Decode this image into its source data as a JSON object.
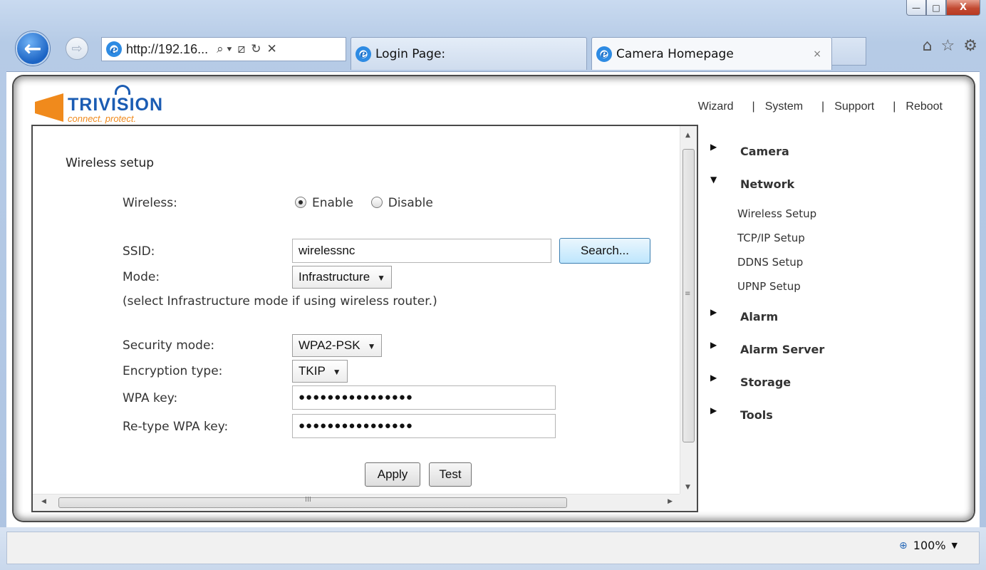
{
  "window": {
    "minimize_glyph": "—",
    "maximize_glyph": "□",
    "close_glyph": "X"
  },
  "browser": {
    "back_glyph": "←",
    "forward_glyph": "⇨",
    "address": "http://192.16...",
    "address_tools": [
      "⌕ ▾",
      "⧄",
      "↻",
      "✕"
    ],
    "tabs": [
      {
        "label": "Login Page:",
        "active": false
      },
      {
        "label": "Camera Homepage",
        "active": true,
        "close_glyph": "×"
      }
    ],
    "tool_icons": [
      {
        "name": "home-icon",
        "glyph": "⌂"
      },
      {
        "name": "favorites-star-icon",
        "glyph": "☆"
      },
      {
        "name": "settings-gear-icon",
        "glyph": "⚙"
      }
    ],
    "zoom": "100%",
    "zoom_icon_glyph": "⊕",
    "zoom_caret": "▼"
  },
  "brand": {
    "name": "TRIVISION",
    "tagline": "connect. protect.",
    "colors": {
      "blue": "#1b5cb3",
      "orange": "#f08a1c"
    }
  },
  "top_menu": {
    "items": [
      "Wizard",
      "System",
      "Support",
      "Reboot"
    ],
    "separator": "|"
  },
  "form": {
    "heading": "Wireless setup",
    "wireless": {
      "label": "Wireless:",
      "options": [
        "Enable",
        "Disable"
      ],
      "selected": "Enable"
    },
    "ssid": {
      "label": "SSID:",
      "value": "wirelessnc",
      "button": "Search..."
    },
    "mode": {
      "label": "Mode:",
      "value": "Infrastructure",
      "hint": "(select Infrastructure mode if using wireless router.)"
    },
    "security_mode": {
      "label": "Security mode:",
      "value": "WPA2-PSK"
    },
    "encryption_type": {
      "label": "Encryption type:",
      "value": "TKIP"
    },
    "wpa_key": {
      "label": "WPA key:",
      "value": "●●●●●●●●●●●●●●●●"
    },
    "retype_wpa_key": {
      "label": "Re-type WPA key:",
      "value": "●●●●●●●●●●●●●●●●"
    },
    "apply_button": "Apply",
    "test_button": "Test",
    "caret": "▼"
  },
  "scrollbars": {
    "up": "▲",
    "down": "▼",
    "left": "◀",
    "right": "▶",
    "v_grip": "≡",
    "h_grip": "III"
  },
  "side_nav": {
    "collapsed_glyph": "▶",
    "expanded_glyph": "▼",
    "groups": [
      {
        "label": "Camera",
        "expanded": false
      },
      {
        "label": "Network",
        "expanded": true,
        "items": [
          "Wireless Setup",
          "TCP/IP Setup",
          "DDNS Setup",
          "UPNP Setup"
        ]
      },
      {
        "label": "Alarm",
        "expanded": false
      },
      {
        "label": "Alarm Server",
        "expanded": false
      },
      {
        "label": "Storage",
        "expanded": false
      },
      {
        "label": "Tools",
        "expanded": false
      }
    ]
  }
}
